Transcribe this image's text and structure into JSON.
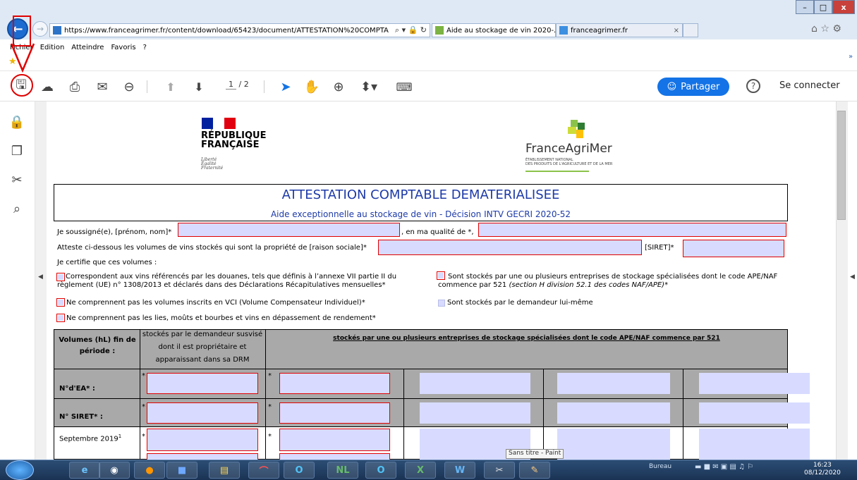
{
  "browser": {
    "address": "https://www.franceagrimer.fr/content/download/65423/document/ATTESTATION%20COMPTA",
    "address_controls": "⌕ ▾ 🔒 ↻",
    "tabs": [
      {
        "label": "Aide au stockage de vin 2020-..."
      },
      {
        "label": "franceagrimer.fr"
      }
    ],
    "tab_close": "×",
    "menu": [
      "Fichier",
      "Edition",
      "Atteindre",
      "Favoris",
      "?"
    ],
    "right_icons": "⌂ ☆ ⚙",
    "more": "»",
    "window_buttons": {
      "min": "–",
      "max": "□",
      "close": "x"
    }
  },
  "toolbar": {
    "page_current": "1",
    "page_total": "/ 2",
    "share_label": "Partager",
    "help": "?",
    "login": "Se connecter"
  },
  "document": {
    "republique": "RÉPUBLIQUE\nFRANÇAISE",
    "motto": "Liberté\nÉgalité\nFraternité",
    "fam_name": "FranceAgriMer",
    "fam_sub": "Établissement national\ndes produits de l'agriculture et de la mer",
    "title": "ATTESTATION COMPTABLE DEMATERIALISEE",
    "subtitle": "Aide exceptionnelle au stockage de vin - Décision INTV GECRI 2020-52",
    "line1_label": "Je soussigné(e), [prénom, nom]*",
    "line1_qualite": ", en ma qualité de *,",
    "line2_label": "Atteste ci-dessous les volumes de vins stockés qui sont la propriété de [raison sociale]*",
    "line2_siret": "[SIRET]*",
    "line3": "Je certifie que ces volumes :",
    "cb1": "Correspondent aux vins référencés par les douanes, tels que définis à l’annexe VII partie II du règlement (UE) n° 1308/2013 et déclarés dans des Déclarations Récapitulatives mensuelles*",
    "cb2": "Ne comprennent pas les volumes inscrits en VCI (Volume Compensateur Individuel)*",
    "cb3": "Ne comprennent pas les lies, moûts et bourbes et vins en dépassement de rendement*",
    "cb4a": "Sont stockés par une ou plusieurs entreprises de stockage spécialisées dont le code APE/NAF commence par 521 ",
    "cb4b": "(section H division 52.1 des codes NAF/APE)*",
    "cb5": "Sont stockés par le demandeur lui-même",
    "table": {
      "h_volumes": "Volumes (hL) fin de période :",
      "h_demandeur": "stockés par le demandeur susvisé dont il est propriétaire et apparaissant dans sa DRM",
      "h_entreprises": "stockés par une ou plusieurs entreprises de stockage spécialisées dont le code APE/NAF commence par 521",
      "rows": [
        {
          "label": "N°d'EA* :"
        },
        {
          "label": "N° SIRET* :"
        },
        {
          "label": "Septembre 2019"
        }
      ],
      "footnote": "1",
      "star": "*"
    }
  },
  "taskbar": {
    "tooltip": "Sans titre - Paint",
    "tray_label": "Bureau",
    "time": "16:23",
    "date": "08/12/2020"
  }
}
